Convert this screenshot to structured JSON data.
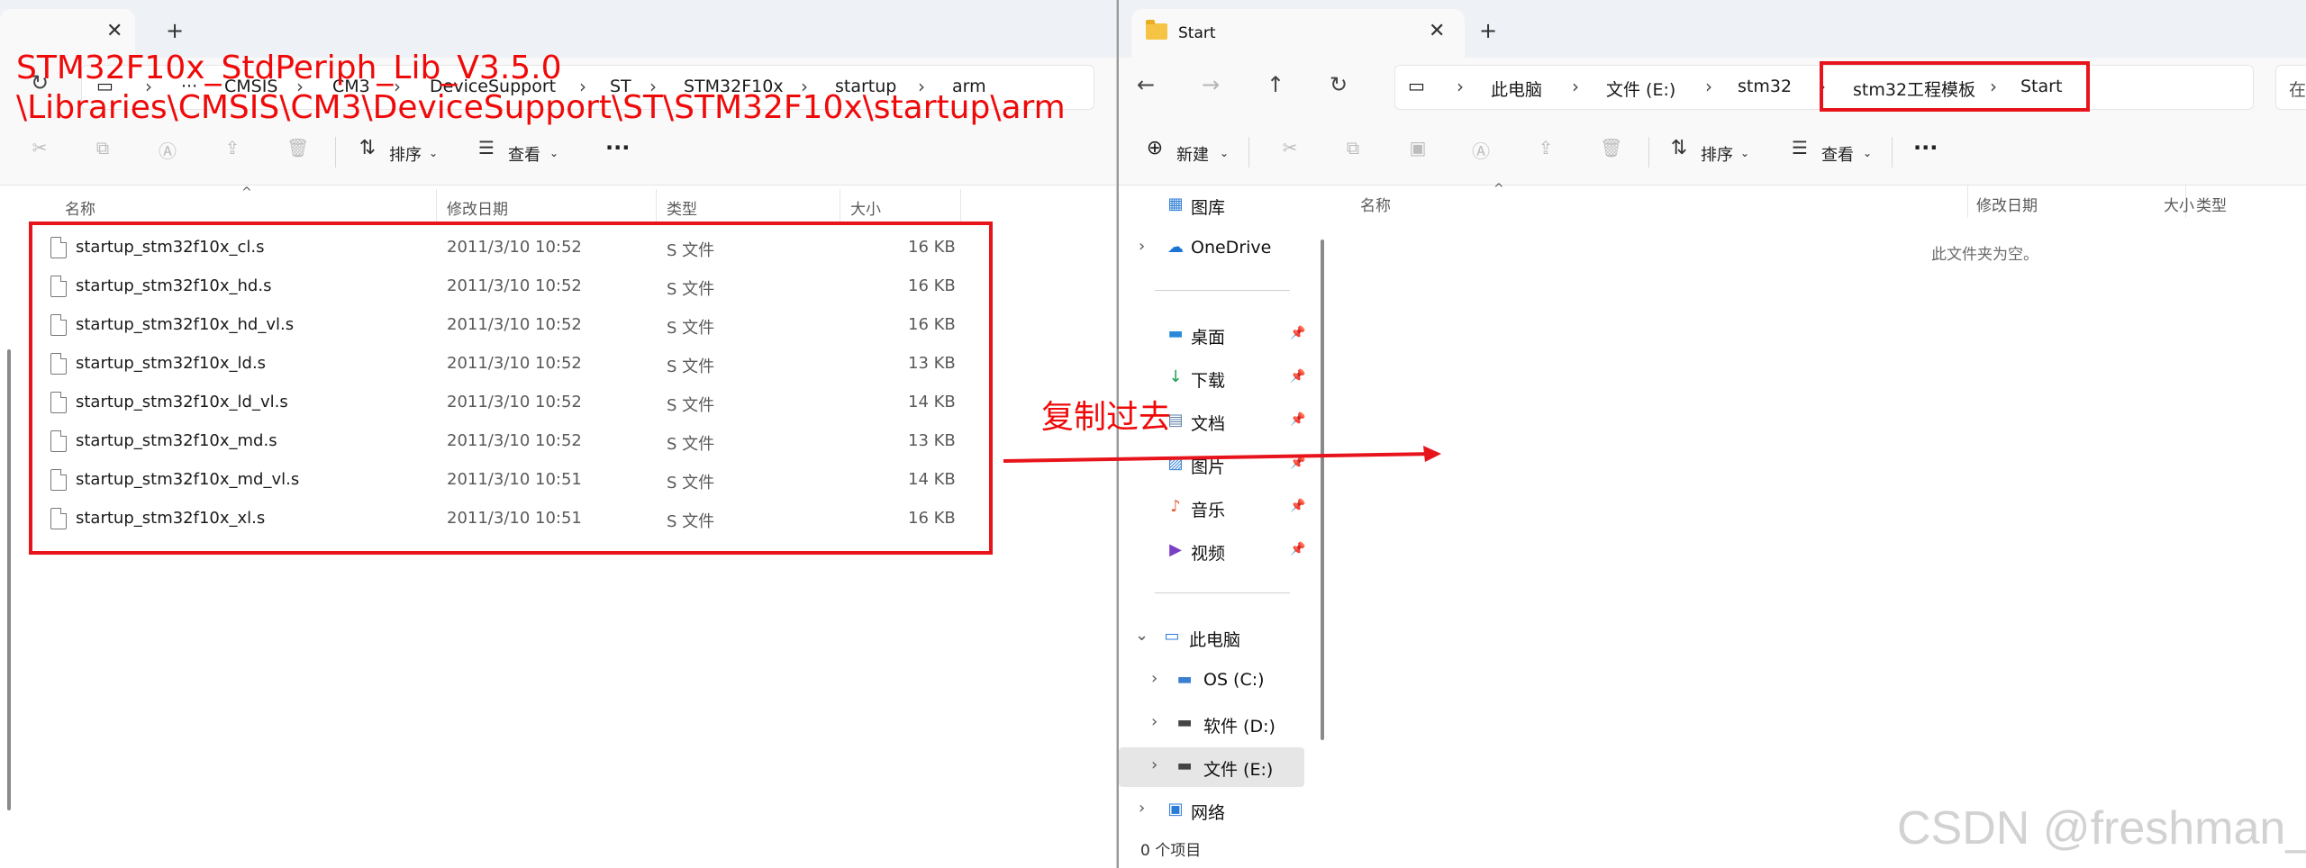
{
  "left_window": {
    "tab_close": "✕",
    "tab_new": "+",
    "breadcrumb_ellipsis": "···",
    "breadcrumbs": [
      "CMSIS",
      "CM3",
      "DeviceSupport",
      "ST",
      "STM32F10x",
      "startup",
      "arm"
    ],
    "commands": {
      "sort": "排序",
      "view": "查看",
      "more": "···"
    },
    "columns": {
      "name": "名称",
      "modified": "修改日期",
      "type": "类型",
      "size": "大小"
    },
    "files": [
      {
        "name": "startup_stm32f10x_cl.s",
        "modified": "2011/3/10 10:52",
        "type": "S 文件",
        "size": "16 KB"
      },
      {
        "name": "startup_stm32f10x_hd.s",
        "modified": "2011/3/10 10:52",
        "type": "S 文件",
        "size": "16 KB"
      },
      {
        "name": "startup_stm32f10x_hd_vl.s",
        "modified": "2011/3/10 10:52",
        "type": "S 文件",
        "size": "16 KB"
      },
      {
        "name": "startup_stm32f10x_ld.s",
        "modified": "2011/3/10 10:52",
        "type": "S 文件",
        "size": "13 KB"
      },
      {
        "name": "startup_stm32f10x_ld_vl.s",
        "modified": "2011/3/10 10:52",
        "type": "S 文件",
        "size": "14 KB"
      },
      {
        "name": "startup_stm32f10x_md.s",
        "modified": "2011/3/10 10:52",
        "type": "S 文件",
        "size": "13 KB"
      },
      {
        "name": "startup_stm32f10x_md_vl.s",
        "modified": "2011/3/10 10:51",
        "type": "S 文件",
        "size": "14 KB"
      },
      {
        "name": "startup_stm32f10x_xl.s",
        "modified": "2011/3/10 10:51",
        "type": "S 文件",
        "size": "16 KB"
      }
    ]
  },
  "right_window": {
    "tab_title": "Start",
    "tab_close": "✕",
    "tab_new": "+",
    "breadcrumbs": [
      "此电脑",
      "文件 (E:)",
      "stm32",
      "stm32工程模板",
      "Start"
    ],
    "search_hint": "在",
    "commands": {
      "new": "新建",
      "sort": "排序",
      "view": "查看",
      "more": "···"
    },
    "columns": {
      "name": "名称",
      "modified": "修改日期",
      "type": "类型",
      "size": "大小"
    },
    "empty_message": "此文件夹为空。",
    "status": "0 个项目",
    "nav": {
      "gallery": "图库",
      "onedrive": "OneDrive",
      "desktop": "桌面",
      "downloads": "下载",
      "documents": "文档",
      "pictures": "图片",
      "music": "音乐",
      "videos": "视频",
      "this_pc": "此电脑",
      "drive_c": "OS (C:)",
      "drive_d": "软件 (D:)",
      "drive_e": "文件 (E:)",
      "network": "网络"
    }
  },
  "annotations": {
    "path_line1": "STM32F10x_StdPeriph_Lib_V3.5.0",
    "path_line2": "\\Libraries\\CMSIS\\CM3\\DeviceSupport\\ST\\STM32F10x\\startup\\arm",
    "copy_label": "复制过去",
    "watermark": "CSDN @freshman_y",
    "highlight_color": "#e8141b"
  }
}
